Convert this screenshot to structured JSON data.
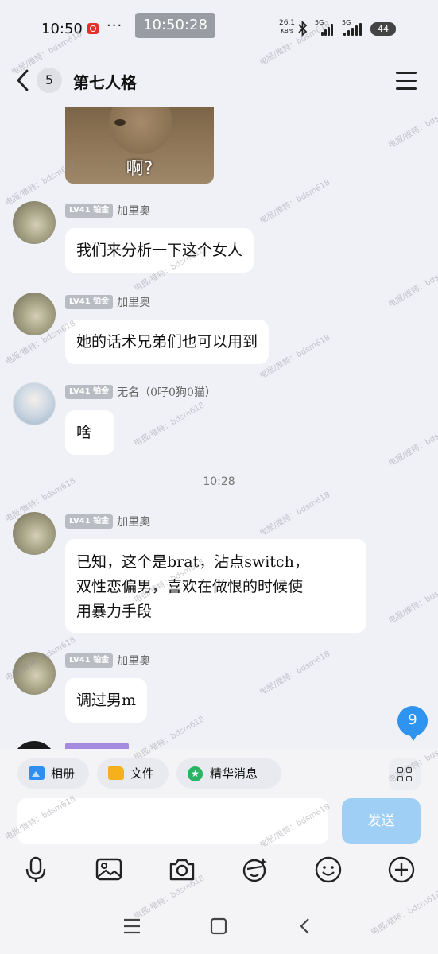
{
  "status": {
    "time": "10:50",
    "dots": "···",
    "clock_overlay": "10:50:28",
    "net_speed_value": "26.1",
    "net_speed_unit": "KB/s",
    "sig1_label": "5G",
    "sig2_label": "5G",
    "battery": "44"
  },
  "header": {
    "unread_count": "5",
    "title": "第七人格"
  },
  "image_message": {
    "caption": "啊?"
  },
  "messages": [
    {
      "level": "LV41 铂金",
      "sender": "加里奥",
      "text": "我们来分析一下这个女人"
    },
    {
      "level": "LV41 铂金",
      "sender": "加里奥",
      "text": "她的话术兄弟们也可以用到"
    },
    {
      "level": "LV41 铂金",
      "sender": "无名（0吇0狗0猫）",
      "text": "啥"
    },
    {
      "level": "LV41 铂金",
      "sender": "加里奥",
      "line1": "已知，这个是brat，沾点switch，",
      "line2": "双性恋偏男，喜欢在做恨的时候使",
      "line3": "用暴力手段"
    },
    {
      "level": "LV41 铂金",
      "sender": "加里奥",
      "text": "调过男m"
    }
  ],
  "time_divider": "10:28",
  "floating_count": "9",
  "panel": {
    "album_label": "相册",
    "file_label": "文件",
    "highlight_label": "精华消息",
    "input_value": "",
    "send_label": "发送"
  },
  "watermark": "电报/推特：bdsm618",
  "colors": {
    "background": "#f0f1f6",
    "bubble": "#ffffff",
    "send_button": "#9fcff5",
    "badge_blue": "#2f93f0",
    "level_badge": "#b9bcc3"
  }
}
